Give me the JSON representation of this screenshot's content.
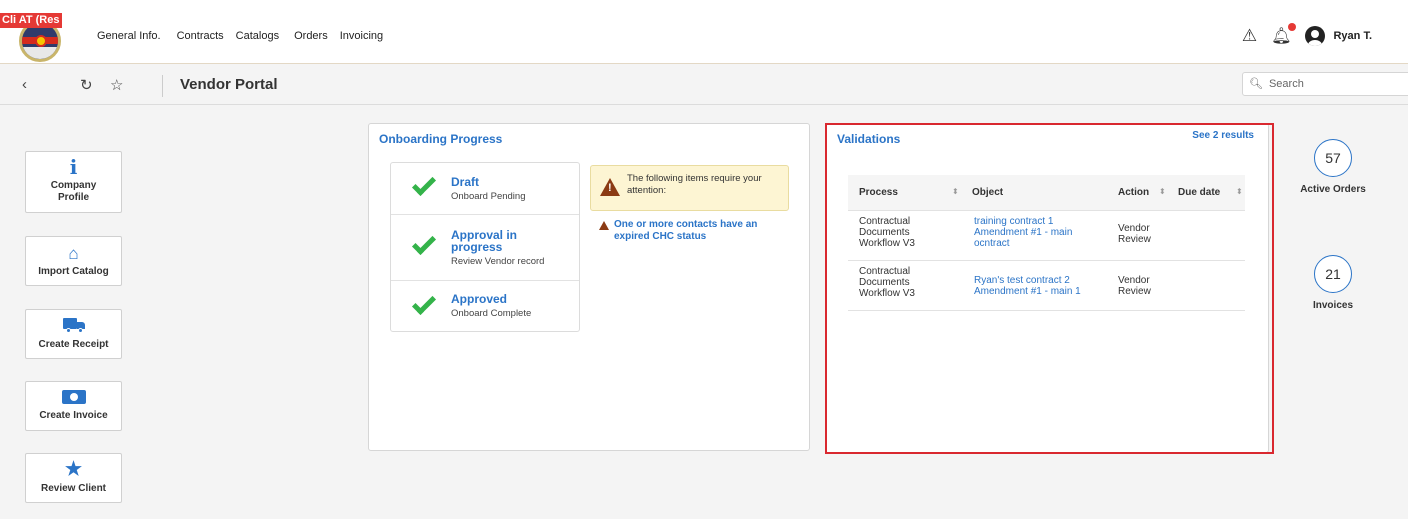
{
  "header": {
    "env_badge": "Cli  AT (Res",
    "nav": [
      "General Info.",
      "Contracts",
      "Catalogs",
      "Orders",
      "Invoicing"
    ],
    "user": "Ryan T."
  },
  "subheader": {
    "title": "Vendor Portal",
    "search_placeholder": "Search"
  },
  "quick_actions": [
    {
      "label": "Company Profile",
      "icon": "info-icon"
    },
    {
      "label": "Import Catalog",
      "icon": "basket-icon"
    },
    {
      "label": "Create Receipt",
      "icon": "truck-icon"
    },
    {
      "label": "Create Invoice",
      "icon": "money-icon"
    },
    {
      "label": "Review Client",
      "icon": "star-icon"
    }
  ],
  "onboarding": {
    "title": "Onboarding Progress",
    "steps": [
      {
        "name": "Draft",
        "status": "Onboard Pending"
      },
      {
        "name": "Approval in progress",
        "status": "Review Vendor record"
      },
      {
        "name": "Approved",
        "status": "Onboard Complete"
      }
    ],
    "attention_text": "The following items require your attention:",
    "attention_item": "One or more contacts have an expired CHC status"
  },
  "validations": {
    "title": "Validations",
    "see_results": "See 2 results",
    "columns": [
      "Process",
      "Object",
      "Action",
      "Due date"
    ],
    "rows": [
      {
        "process": "Contractual Documents Workflow V3",
        "object": "training contract 1 Amendment #1 - main ocntract",
        "action": "Vendor Review",
        "due": ""
      },
      {
        "process": "Contractual Documents Workflow V3",
        "object": "Ryan's test contract 2 Amendment #1 - main 1",
        "action": "Vendor Review",
        "due": ""
      }
    ]
  },
  "stats": [
    {
      "value": "57",
      "label": "Active Orders"
    },
    {
      "value": "21",
      "label": "Invoices"
    }
  ],
  "colors": {
    "accent": "#2b74c7",
    "success": "#34b34a",
    "highlight": "#d9282f",
    "notification": "#e53935"
  }
}
